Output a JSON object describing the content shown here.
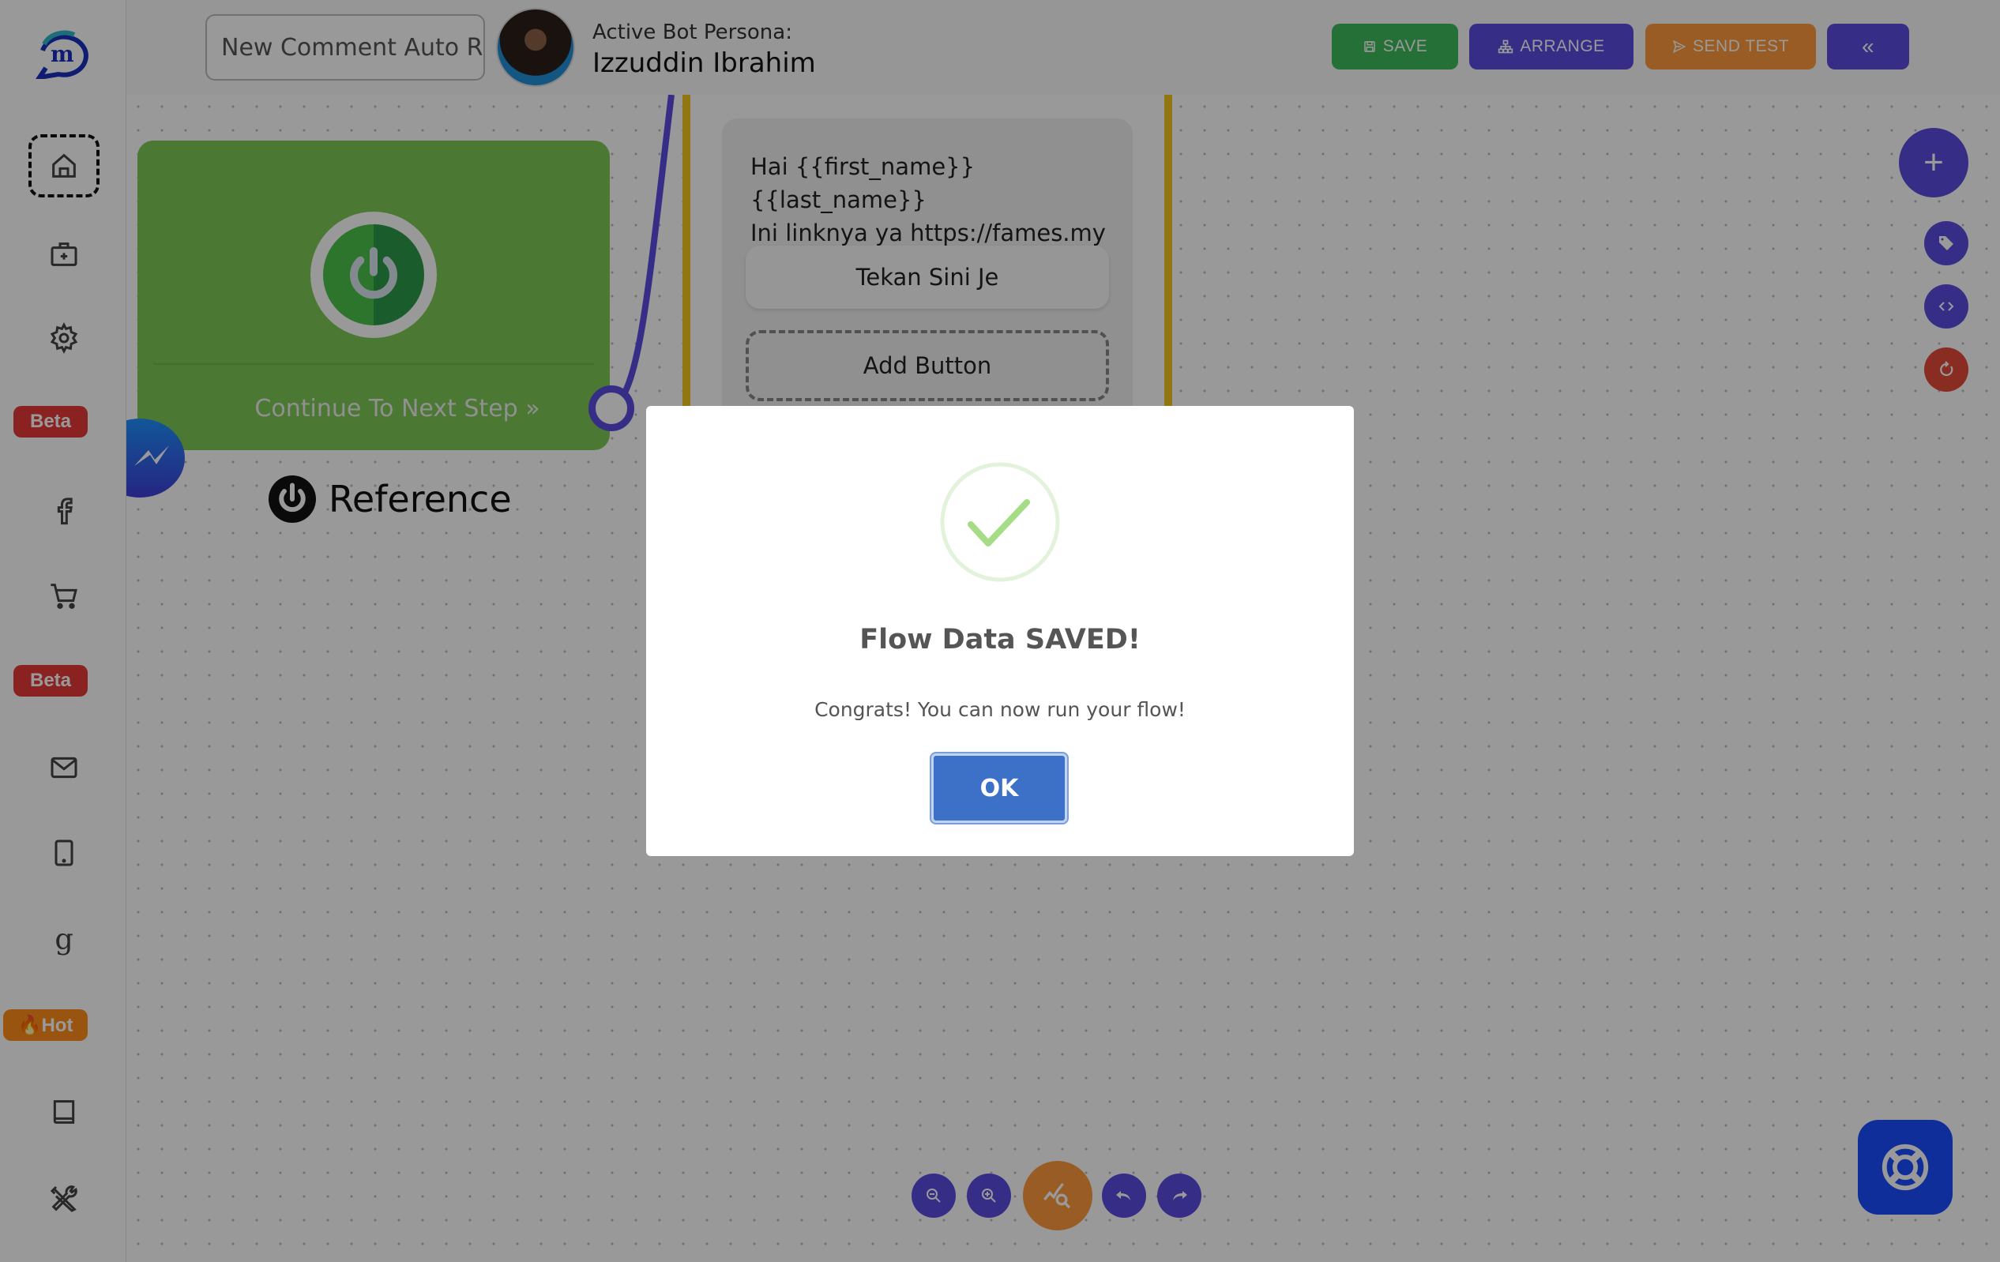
{
  "sidebar": {
    "items": [
      {
        "icon": "home-icon",
        "active": true
      },
      {
        "icon": "briefcase-plus-icon"
      },
      {
        "icon": "gear-icon"
      },
      {
        "badge": "Beta"
      },
      {
        "icon": "facebook-icon"
      },
      {
        "icon": "cart-icon"
      },
      {
        "badge": "Beta"
      },
      {
        "icon": "mail-icon"
      },
      {
        "icon": "tablet-icon"
      },
      {
        "icon": "google-icon"
      },
      {
        "badge": "🔥Hot"
      },
      {
        "icon": "book-icon"
      },
      {
        "icon": "tools-icon"
      }
    ]
  },
  "header": {
    "flow_name": "New Comment Auto R",
    "persona_label": "Active Bot Persona:",
    "persona_name": "Izzuddin Ibrahim",
    "save_label": "SAVE",
    "arrange_label": "ARRANGE",
    "send_test_label": "SEND TEST",
    "collapse_label": "«"
  },
  "canvas": {
    "start_node": {
      "continue_label": "Continue To Next Step »",
      "reference_label": "Reference"
    },
    "message_node": {
      "text_line1": "Hai {{first_name}} {{last_name}}",
      "text_line2": "Ini linknya ya https://fames.my",
      "button_label": "Tekan Sini Je",
      "add_button_label": "Add Button"
    },
    "fab_add_label": "+"
  },
  "colors": {
    "accent_purple": "#5a4ee0",
    "save_green": "#3dbb5d",
    "send_orange": "#ff9a3c",
    "reset_red": "#e44a3a",
    "help_blue": "#1a4dff",
    "node_yellow": "#f2c51e"
  },
  "modal": {
    "title": "Flow Data SAVED!",
    "message": "Congrats! You can now run your flow!",
    "ok_label": "OK"
  }
}
